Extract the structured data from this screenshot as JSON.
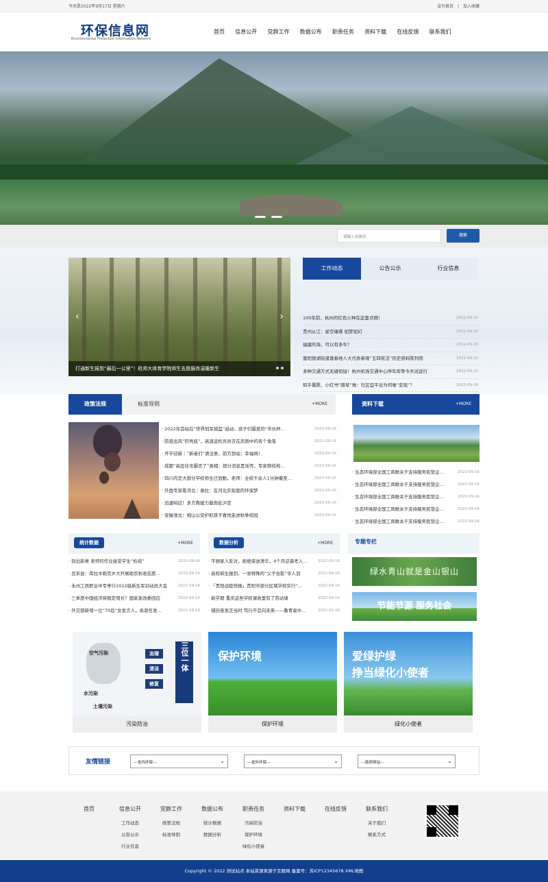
{
  "topbar": {
    "date": "今天是2022年9月17日 星期六",
    "set_home": "设为首页",
    "sep": "|",
    "add_fav": "加入收藏"
  },
  "logo": {
    "cn": "环保信息网",
    "en": "Environmental Protection Information Network"
  },
  "nav": [
    "首页",
    "信息公开",
    "党群工作",
    "数据公布",
    "职责任务",
    "资料下载",
    "在线反馈",
    "联系我们"
  ],
  "search": {
    "placeholder": "请输入关键词",
    "button": "搜索"
  },
  "slider": {
    "caption": "打通新生报到“最后一公里”！杭师大体育学院师生志愿服务温暖新生"
  },
  "news_tabs": {
    "tabs": [
      "工作动态",
      "公告公示",
      "行业信息"
    ],
    "items": [
      {
        "title": "100年前，杭州的红色火种在这里点燃！",
        "date": "2022-09-16"
      },
      {
        "title": "贵州从江：星空璀璨 如梦如幻",
        "date": "2022-09-16"
      },
      {
        "title": "福建的海，可以有多牛？",
        "date": "2022-09-16"
      },
      {
        "title": "富阳银湖街道富春地人大代表参观“五四宪法”历史资料陈列馆",
        "date": "2022-09-16"
      },
      {
        "title": "多种交通方式无缝衔接！杭州机场交通中心停车库等今天试运行",
        "date": "2022-09-16"
      },
      {
        "title": "知乎暴跌、小红书“蹭草”难：社区型平台为何难“变现”？",
        "date": "2022-09-16"
      }
    ]
  },
  "policy": {
    "tabs": [
      "政策法规",
      "标准导则"
    ],
    "more": "+MORE",
    "items": [
      {
        "title": "· 2022年首站在“世界冠军摇篮”启动，孩子们最爱的“市长杯...",
        "date": "2022-09-16"
      },
      {
        "title": "· 防疫出风“轩亮底”，高速运检员员去在风雨中的各个角落",
        "date": "2022-09-16"
      },
      {
        "title": "· 开学迎新｜“新者们”请注意，前方到站：幸福阀！",
        "date": "2022-09-16"
      },
      {
        "title": "· 成都“高层住宅霸否了”真相：部分消息是谣传，专家称结构...",
        "date": "2022-09-16"
      },
      {
        "title": "· 四川内定大部分学校师生已到勤，老师：全校千余人1分钟撤至...",
        "date": "2022-09-16"
      },
      {
        "title": "· 外国专家看河北｜泰拉：在河北实现我的环保梦",
        "date": "2022-09-16"
      },
      {
        "title": "· 迅速响应！多方救援力量奔赴泸定",
        "date": "2022-09-16"
      },
      {
        "title": "· 安徽淮北：相山公安护航孩子喜悦走进秋季校园",
        "date": "2022-09-16"
      }
    ]
  },
  "downloads": {
    "title": "资料下载",
    "more": "+MORE",
    "items": [
      {
        "title": "· 生态环境部全国工商联关于支持服务民营企...",
        "date": "2022-09-16"
      },
      {
        "title": "· 生态环境部全国工商联关于支持服务民营企...",
        "date": "2022-09-16"
      },
      {
        "title": "· 生态环境部全国工商联关于支持服务民营企...",
        "date": "2022-09-16"
      },
      {
        "title": "· 生态环境部全国工商联关于支持服务民营企...",
        "date": "2022-09-16"
      },
      {
        "title": "· 生态环境部全国工商联关于支持服务民营企...",
        "date": "2022-09-16"
      }
    ]
  },
  "stats": {
    "title": "统计数据",
    "more": "+MORE",
    "items": [
      {
        "title": "· 别出新意 老师的作业接受学生“检阅”",
        "date": "2022-09-16"
      },
      {
        "title": "· 且末县：库拉木勒克乡大开展助农秋收志愿...",
        "date": "2022-09-16"
      },
      {
        "title": "· 永州工商职业中专举行2022级新生军训动员大会",
        "date": "2022-09-16"
      },
      {
        "title": "· 三季度中国经济将稳定增长？国家发改委回应",
        "date": "2022-09-16"
      },
      {
        "title": "· 外交部新增一位“70后”女发言人，系驱任发...",
        "date": "2022-09-16"
      }
    ]
  },
  "analysis": {
    "title": "数据分析",
    "more": "+MORE",
    "items": [
      {
        "title": "· 不顾家人反对，拒绝保送清华，4个月逆袭考入...",
        "date": "2022-09-16"
      },
      {
        "title": "· 高校新生报到，一张特殊的“父子合影”令人泪",
        "date": "2022-09-16"
      },
      {
        "title": "· 「贵阳战疫快报」贵阳市部分区域学校实行“...",
        "date": "2022-09-16"
      },
      {
        "title": "· 新学期 重庆这些学校课表里有了劳动课",
        "date": "2022-09-16"
      },
      {
        "title": "· 辅历奋发正当时 笃行不怠向未来——鲁青高中...",
        "date": "2022-09-16"
      }
    ]
  },
  "special": {
    "title": "专题专栏",
    "banner1": "绿水青山就是金山银山",
    "banner2": "节能节源 服务社会"
  },
  "cards": [
    {
      "caption": "污染防治",
      "labels": [
        "空气污染",
        "治理",
        "清洁",
        "修复",
        "水污染",
        "土壤污染",
        "三位一体"
      ]
    },
    {
      "caption": "保护环境",
      "headline": "保护环境"
    },
    {
      "caption": "绿化小使者",
      "headline1": "爱绿护绿",
      "headline2": "挣当绿化小使者"
    }
  ],
  "friend_links": {
    "title": "友情链接",
    "selects": [
      "---省内环保---",
      "---省外环保---",
      "---政府网站---"
    ]
  },
  "footer": {
    "cols": [
      {
        "head": "首页",
        "subs": []
      },
      {
        "head": "信息公开",
        "subs": [
          "工作动态",
          "公告公示",
          "行业信息"
        ]
      },
      {
        "head": "党群工作",
        "subs": [
          "政策法规",
          "标准导则"
        ]
      },
      {
        "head": "数据公布",
        "subs": [
          "统计数据",
          "数据分析"
        ]
      },
      {
        "head": "职责任务",
        "subs": [
          "污染防治",
          "保护环境",
          "绿化小使者"
        ]
      },
      {
        "head": "资料下载",
        "subs": []
      },
      {
        "head": "在线反馈",
        "subs": []
      },
      {
        "head": "联系我们",
        "subs": [
          "关于我们",
          "联系方式"
        ]
      }
    ],
    "copyright": "Copyright © 2022 测试站点 本站资源来源于互联网 备案号：苏ICP12345678 XML地图"
  },
  "colors": {
    "brand_blue": "#17489c",
    "footer_blue": "#123e8e",
    "search_blue": "#1f5aa6"
  }
}
